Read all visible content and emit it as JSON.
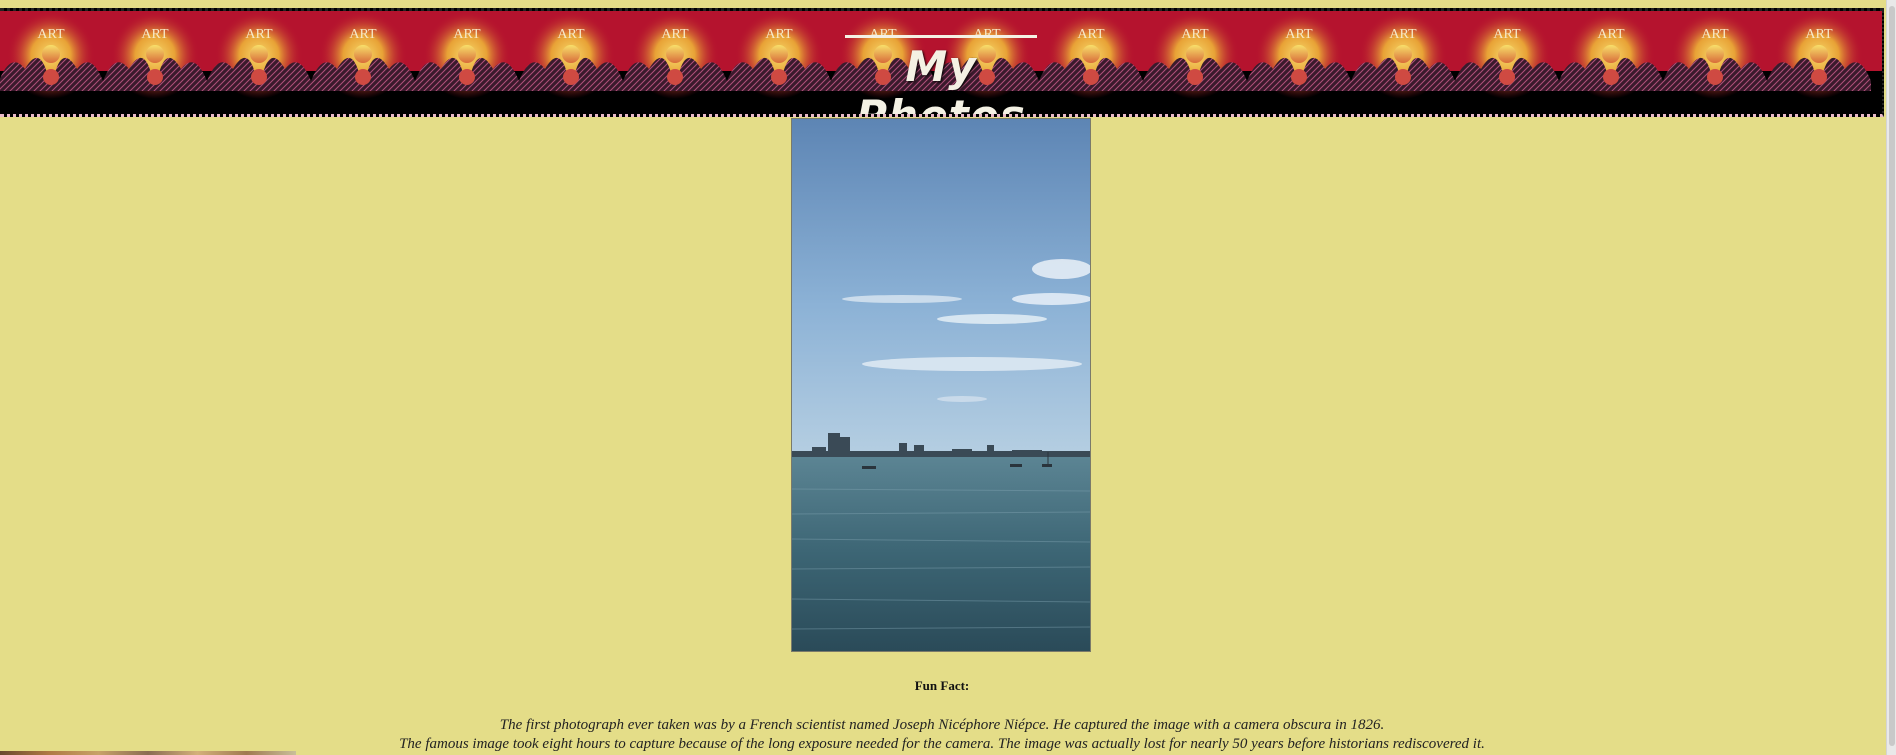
{
  "header": {
    "title": "My Photos",
    "pattern_label": "ART",
    "colors": {
      "band_top": "#b5132e",
      "band_bottom": "#000000",
      "sun_core": "#f5c14a",
      "title_text": "#f4f1e4"
    }
  },
  "page": {
    "background_color": "#e4dd88"
  },
  "photo": {
    "description_icon": "photo-image"
  },
  "fun_fact": {
    "label": "Fun Fact:",
    "line1": "The first photograph ever taken was by a French scientist named Joseph Nicéphore Niépce. He captured the image with a camera obscura in 1826.",
    "line2": "The famous image took eight hours to capture because of the long exposure needed for the camera. The image was actually lost for nearly 50 years before historians rediscovered it."
  }
}
